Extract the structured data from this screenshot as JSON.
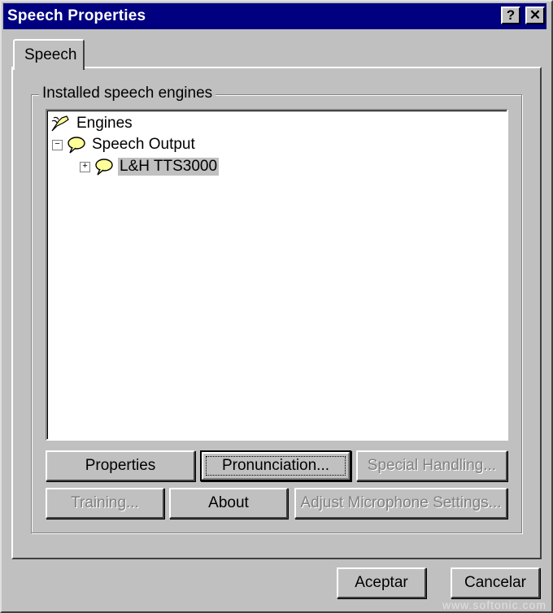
{
  "window": {
    "title": "Speech Properties",
    "help_btn": "?",
    "close_btn": "✕"
  },
  "tabs": [
    {
      "label": "Speech",
      "active": true
    }
  ],
  "group": {
    "label": "Installed speech engines"
  },
  "tree": {
    "root": {
      "label": "Engines",
      "icon": "engines-icon"
    },
    "child": {
      "label": "Speech Output",
      "icon": "speech-bubble-icon",
      "expander": "−"
    },
    "grandchild": {
      "label": "L&H TTS3000",
      "icon": "speech-bubble-icon",
      "expander": "+",
      "selected": true
    }
  },
  "buttons": {
    "properties": "Properties",
    "pronunciation": "Pronunciation...",
    "special_handling": "Special Handling...",
    "training": "Training...",
    "about": "About",
    "adjust_mic": "Adjust Microphone Settings..."
  },
  "footer": {
    "ok": "Aceptar",
    "cancel": "Cancelar"
  },
  "watermark": "www.softonic.com",
  "colors": {
    "titlebar": "#000080",
    "face": "#c0c0c0",
    "bubble": "#ffff99"
  }
}
